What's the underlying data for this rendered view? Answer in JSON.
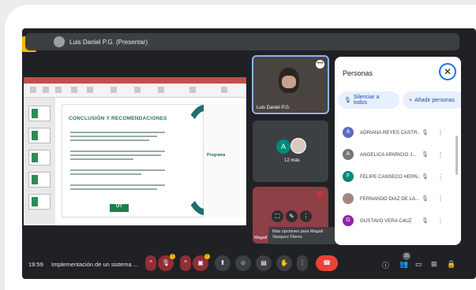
{
  "header": {
    "presenter_title": "Luis Daniel P.G. (Presentar)"
  },
  "slide": {
    "title": "CONCLUSIÓN Y RECOMENDACIONES",
    "side_label": "Programa",
    "logo_text": "UT"
  },
  "tiles": {
    "presenter_name": "Luis Daniel P.G.",
    "avatar_letter": "A",
    "more_count": "12 más",
    "magali_name": "Magali Vazquez Flores"
  },
  "tooltip": {
    "text": "Más opciones para Magali Vazquez Flores"
  },
  "panel": {
    "title": "Personas",
    "mute_all_label": "Silenciar a todos",
    "add_people_label": "Añadir personas",
    "participants": [
      {
        "initial": "A",
        "name": "ADRIANA REYES CASTR...",
        "color": "#5c6bc0"
      },
      {
        "initial": "A",
        "name": "ANGELICA APARICIO J...",
        "color": "#757575"
      },
      {
        "initial": "F",
        "name": "FELIPE CANSECO HERN...",
        "color": "#00897b"
      },
      {
        "initial": "",
        "name": "FERNANDO DIAZ DE LA...",
        "color": "#a1887f"
      },
      {
        "initial": "G",
        "name": "GUSTAVO VERA C4UZ",
        "color": "#8e24aa"
      }
    ]
  },
  "bottombar": {
    "time": "19:59",
    "meeting_title": "Implementación de un sistema ...",
    "people_count": "15"
  },
  "colors": {
    "accent": "#1a73e8",
    "end_call": "#ea4335",
    "muted": "#8f2f35"
  }
}
